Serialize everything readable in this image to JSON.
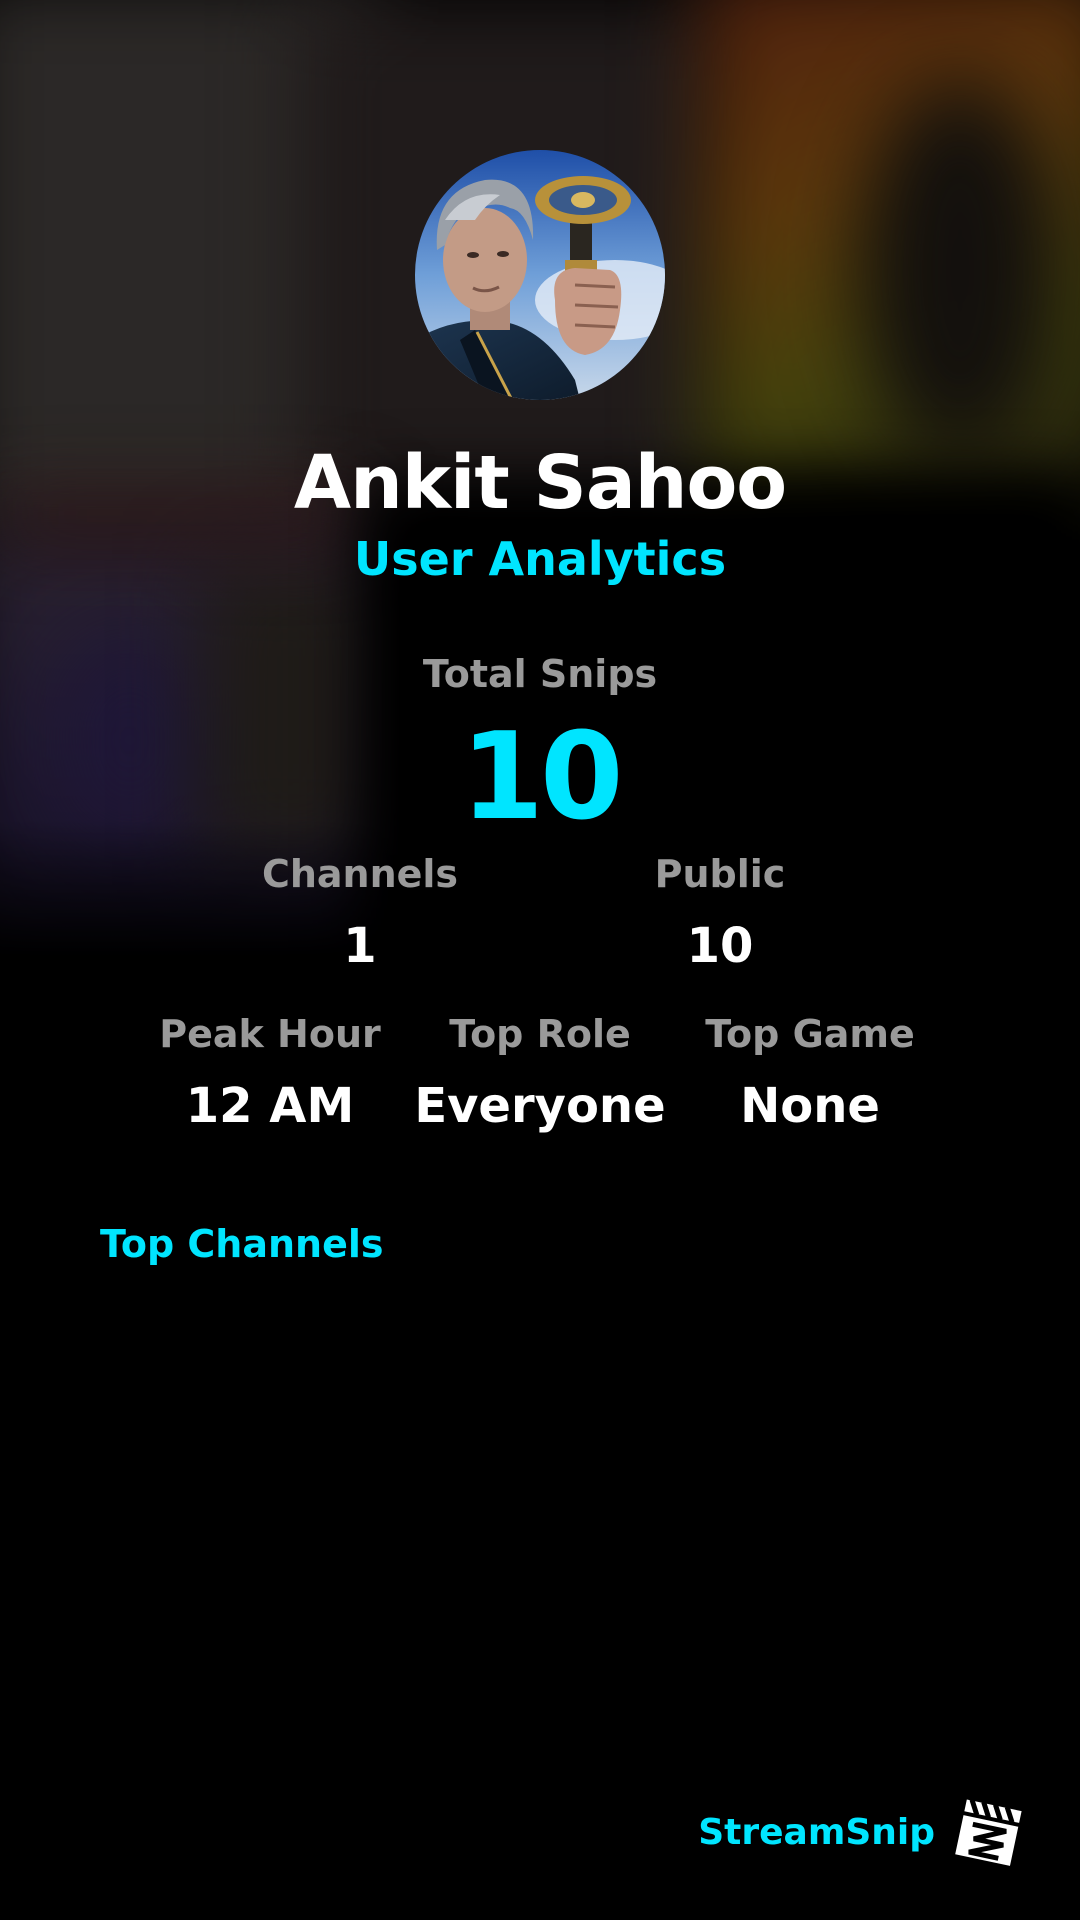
{
  "profile": {
    "name": "Ankit Sahoo",
    "subtitle": "User Analytics"
  },
  "stats": {
    "total_snips": {
      "label": "Total Snips",
      "value": "10"
    },
    "channels": {
      "label": "Channels",
      "value": "1"
    },
    "public": {
      "label": "Public",
      "value": "10"
    },
    "peak_hour": {
      "label": "Peak Hour",
      "value": "12 AM"
    },
    "top_role": {
      "label": "Top Role",
      "value": "Everyone"
    },
    "top_game": {
      "label": "Top Game",
      "value": "None"
    }
  },
  "sections": {
    "top_channels": "Top Channels"
  },
  "brand": {
    "name": "StreamSnip",
    "logo_icon": "clapperboard-icon"
  },
  "colors": {
    "accent": "#00e5ff",
    "background": "#000000",
    "label": "#9a9a9a",
    "value": "#ffffff"
  }
}
